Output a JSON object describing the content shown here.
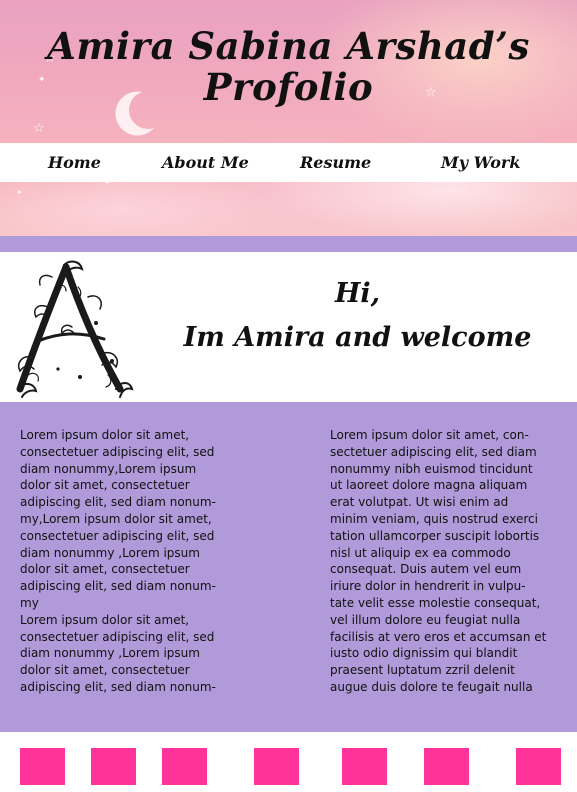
{
  "header": {
    "title_line1": "Amira Sabina Arshad’s",
    "title_line2": "Profolio",
    "nav": [
      {
        "label": "Home"
      },
      {
        "label": "About Me"
      },
      {
        "label": "Resume"
      },
      {
        "label": "My Work"
      }
    ]
  },
  "intro": {
    "greeting_line1": "Hi,",
    "greeting_line2": "Im Amira and welcome",
    "monogram_icon": "floral-letter-a-icon"
  },
  "content": {
    "left_paragraphs": [
      "Lorem ipsum dolor sit amet, consectetuer adipiscing elit, sed diam nonummy,Lorem ipsum dolor sit amet, consectetuer adipiscing elit, sed diam nonum-my,Lorem ipsum dolor sit amet, consectetuer adipiscing elit, sed diam nonummy ,Lorem ipsum dolor sit amet, consectetuer adipiscing elit, sed diam nonum-my",
      "Lorem ipsum dolor sit amet, consectetuer adipiscing elit, sed diam nonummy ,Lorem ipsum dolor sit amet, consectetuer adipiscing elit, sed diam nonum-"
    ],
    "right_paragraph": "Lorem ipsum dolor sit amet, con-sectetuer adipiscing elit, sed diam nonummy nibh euismod tincidunt ut laoreet dolore magna aliquam erat volutpat. Ut wisi enim ad minim veniam, quis nostrud exerci tation ullamcorper suscipit lobortis nisl ut aliquip ex ea commodo consequat. Duis autem vel eum iriure dolor in hendrerit in vulpu-tate velit esse molestie consequat, vel illum dolore eu feugiat nulla facilisis at vero eros et accumsan et iusto odio dignissim qui blandit praesent luptatum zzril delenit augue duis dolore te feugait nulla"
  },
  "footer": {
    "buttons_count_visible": 7
  },
  "colors": {
    "accent_purple": "#b09ad9",
    "button_pink": "#ff3399",
    "text": "#111111"
  }
}
